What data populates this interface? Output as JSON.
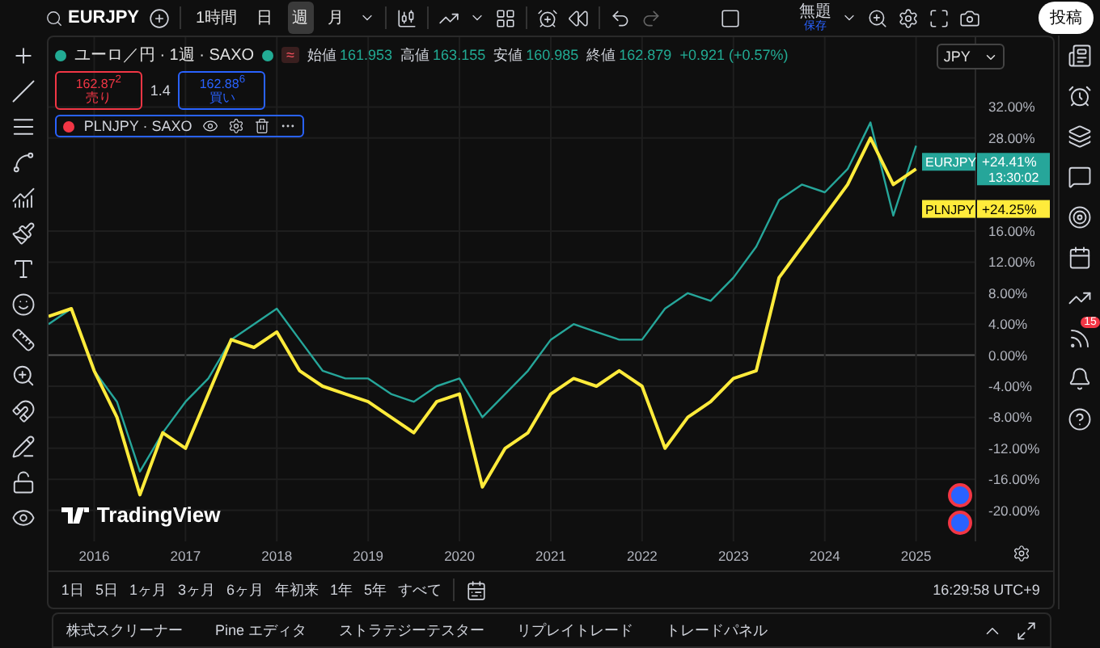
{
  "toolbar": {
    "symbol": "EURJPY",
    "intervals": [
      {
        "label": "1時間",
        "selected": false
      },
      {
        "label": "日",
        "selected": false
      },
      {
        "label": "週",
        "selected": true
      },
      {
        "label": "月",
        "selected": false
      }
    ],
    "layout_name": "無題",
    "save_label": "保存",
    "post_button": "投稿"
  },
  "legend": {
    "title": "ユーロ／円 · 1週 · SAXO",
    "market_badge": "≈",
    "ohlc": [
      {
        "label": "始値",
        "value": "161.953"
      },
      {
        "label": "高値",
        "value": "163.155"
      },
      {
        "label": "安値",
        "value": "160.985"
      },
      {
        "label": "終値",
        "value": "162.879"
      }
    ],
    "change": "+0.921 (+0.57%)",
    "sell": {
      "price": "162.87$^{2}$",
      "label": "売り"
    },
    "spread": "1.4",
    "buy": {
      "price": "162.88$^{6}$",
      "label": "買い"
    },
    "compare": "PLNJPY · SAXO"
  },
  "currency": "JPY",
  "chart_data": {
    "type": "line",
    "grid": true,
    "xlim": [
      2015.5,
      2025.65
    ],
    "x": [
      2015.5,
      2015.75,
      2016,
      2016.25,
      2016.5,
      2016.75,
      2017,
      2017.25,
      2017.5,
      2017.75,
      2018,
      2018.25,
      2018.5,
      2018.75,
      2019,
      2019.25,
      2019.5,
      2019.75,
      2020,
      2020.25,
      2020.5,
      2020.75,
      2021,
      2021.25,
      2021.5,
      2021.75,
      2022,
      2022.25,
      2022.5,
      2022.75,
      2023,
      2023.25,
      2023.5,
      2023.75,
      2024,
      2024.25,
      2024.5,
      2024.75,
      2025
    ],
    "series": [
      {
        "name": "EURJPY",
        "color": "#26a69a",
        "values": [
          4,
          6,
          -2,
          -6,
          -15,
          -10,
          -6,
          -3,
          2,
          4,
          6,
          2,
          -2,
          -3,
          -3,
          -5,
          -6,
          -4,
          -3,
          -8,
          -5,
          -2,
          2,
          4,
          3,
          2,
          2,
          6,
          8,
          7,
          10,
          14,
          20,
          22,
          21,
          24,
          30,
          18,
          27
        ]
      },
      {
        "name": "PLNJPY",
        "color": "#ffeb3b",
        "values": [
          5,
          6,
          -2,
          -8,
          -18,
          -10,
          -12,
          -5,
          2,
          1,
          3,
          -2,
          -4,
          -5,
          -6,
          -8,
          -10,
          -6,
          -5,
          -17,
          -12,
          -10,
          -5,
          -3,
          -4,
          -2,
          -4,
          -12,
          -8,
          -6,
          -3,
          -2,
          10,
          14,
          18,
          22,
          28,
          22,
          24
        ]
      }
    ],
    "xticks": [
      2016,
      2017,
      2018,
      2019,
      2020,
      2021,
      2022,
      2023,
      2024,
      2025
    ],
    "yticks": [
      {
        "value": -20,
        "label": "-20.00%"
      },
      {
        "value": -16,
        "label": "-16.00%"
      },
      {
        "value": -12,
        "label": "-12.00%"
      },
      {
        "value": -8,
        "label": "-8.00%"
      },
      {
        "value": -4,
        "label": "-4.00%"
      },
      {
        "value": 0,
        "label": "0.00%"
      },
      {
        "value": 4,
        "label": "4.00%"
      },
      {
        "value": 8,
        "label": "8.00%"
      },
      {
        "value": 12,
        "label": "12.00%"
      },
      {
        "value": 16,
        "label": "16.00%"
      },
      {
        "value": 28,
        "label": "28.00%"
      },
      {
        "value": 32,
        "label": "32.00%"
      }
    ],
    "ylim": [
      -24,
      41
    ]
  },
  "price_tags": [
    {
      "value": "+24.41%",
      "time": "13:30:02",
      "color": "#26a69a"
    },
    {
      "value": "+24.25%",
      "color": "#ffeb3b"
    }
  ],
  "ranges": [
    "1日",
    "5日",
    "1ヶ月",
    "3ヶ月",
    "6ヶ月",
    "年初来",
    "1年",
    "5年",
    "すべて"
  ],
  "clock": "16:29:58 UTC+9",
  "bottom_tabs": [
    "株式スクリーナー",
    "Pine エディタ",
    "ストラテジーテスター",
    "リプレイトレード",
    "トレードパネル"
  ],
  "logo": "TradingView",
  "notifications": "15"
}
